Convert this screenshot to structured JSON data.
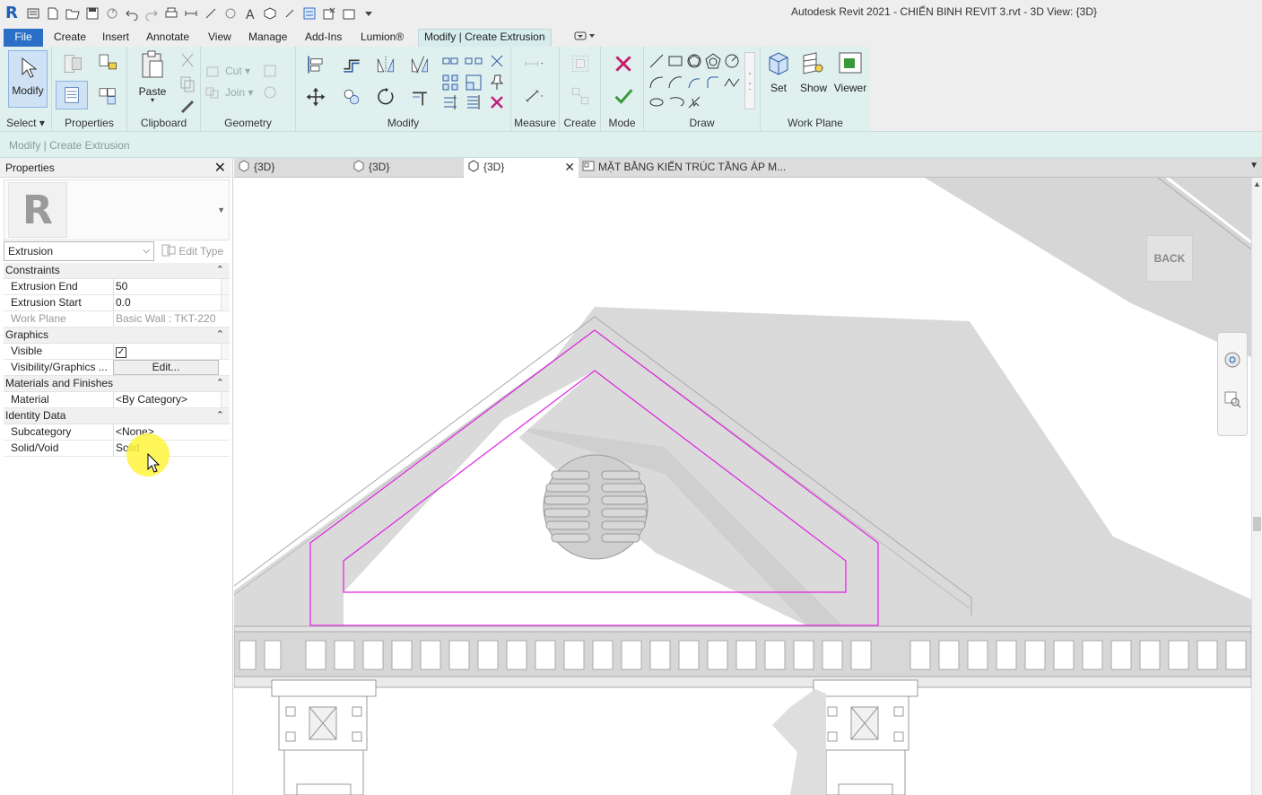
{
  "window": {
    "title": "Autodesk Revit 2021 - CHIẾN BINH REVIT 3.rvt - 3D View: {3D}",
    "app_logo": "R"
  },
  "menu": {
    "tabs": [
      "File",
      "Create",
      "Insert",
      "Annotate",
      "View",
      "Manage",
      "Add-Ins",
      "Lumion®",
      "Modify | Create Extrusion"
    ],
    "active_context": "Modify | Create Extrusion"
  },
  "ribbon": {
    "select": {
      "modify_label": "Modify",
      "panel_label": "Select"
    },
    "properties": {
      "panel_label": "Properties"
    },
    "clipboard": {
      "paste_label": "Paste",
      "panel_label": "Clipboard"
    },
    "geometry": {
      "cut_label": "Cut",
      "join_label": "Join",
      "panel_label": "Geometry"
    },
    "modify": {
      "panel_label": "Modify"
    },
    "measure": {
      "panel_label": "Measure"
    },
    "create": {
      "panel_label": "Create"
    },
    "mode": {
      "panel_label": "Mode"
    },
    "draw": {
      "panel_label": "Draw"
    },
    "workplane": {
      "set_label": "Set",
      "show_label": "Show",
      "viewer_label": "Viewer",
      "panel_label": "Work Plane"
    }
  },
  "options_bar": {
    "text": "Modify | Create Extrusion"
  },
  "properties_panel": {
    "title": "Properties",
    "type_logo": "R",
    "type_name": "Extrusion",
    "edit_type_label": "Edit Type",
    "groups": {
      "constraints": "Constraints",
      "graphics": "Graphics",
      "materials": "Materials and Finishes",
      "identity": "Identity Data"
    },
    "rows": {
      "extrusion_end": {
        "key": "Extrusion End",
        "value": "50"
      },
      "extrusion_start": {
        "key": "Extrusion Start",
        "value": "0.0"
      },
      "work_plane": {
        "key": "Work Plane",
        "value": "Basic Wall : TKT-220"
      },
      "visible": {
        "key": "Visible",
        "value": "✓"
      },
      "visibility_graphics": {
        "key": "Visibility/Graphics ...",
        "value": "Edit..."
      },
      "material": {
        "key": "Material",
        "value": "<By Category>"
      },
      "subcategory": {
        "key": "Subcategory",
        "value": "<None>"
      },
      "solid_void": {
        "key": "Solid/Void",
        "value": "Solid"
      }
    }
  },
  "doc_tabs": [
    {
      "label": "{3D}",
      "active": false
    },
    {
      "label": "{3D}",
      "active": false
    },
    {
      "label": "{3D}",
      "active": true
    },
    {
      "label": "MẶT BẰNG KIẾN TRÚC TẦNG ÁP M...",
      "active": false
    }
  ],
  "viewcube": {
    "face_label": "BACK"
  },
  "colors": {
    "file_tab": "#2c6fc6",
    "ribbon_context": "#dff0ef",
    "sketch_lines": "#e020e0",
    "cancel_mode": "#d0205a",
    "finish_mode": "#3a9a3a"
  }
}
